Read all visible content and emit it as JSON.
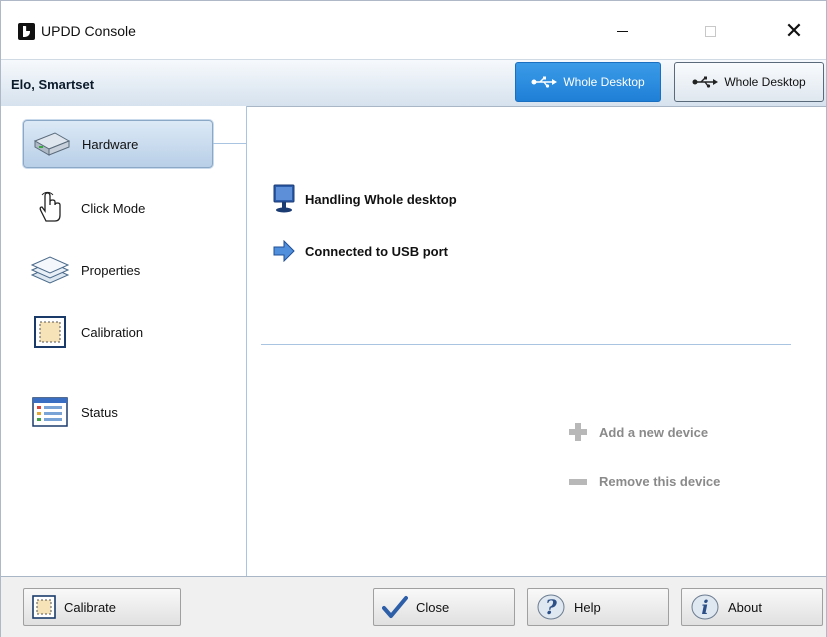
{
  "window": {
    "title": "UPDD Console",
    "minimize_glyph": "—",
    "close_glyph": "✕"
  },
  "device_bar": {
    "device_name": "Elo, Smartset",
    "buttons": [
      {
        "label": "Whole Desktop",
        "state": "active",
        "icon": "usb-icon"
      },
      {
        "label": "Whole Desktop",
        "state": "inactive",
        "icon": "usb-icon"
      }
    ]
  },
  "nav": {
    "items": [
      {
        "label": "Hardware",
        "icon": "hard-drive-icon",
        "selected": true
      },
      {
        "label": "Click Mode",
        "icon": "hand-pointer-icon",
        "selected": false
      },
      {
        "label": "Properties",
        "icon": "layers-icon",
        "selected": false
      },
      {
        "label": "Calibration",
        "icon": "calibration-icon",
        "selected": false
      },
      {
        "label": "Status",
        "icon": "status-grid-icon",
        "selected": false
      }
    ]
  },
  "content": {
    "info": [
      {
        "text": "Handling Whole desktop",
        "icon": "monitor-icon"
      },
      {
        "text": "Connected to USB port",
        "icon": "arrow-right-icon"
      }
    ],
    "actions": [
      {
        "label": "Add a new device",
        "icon": "plus-icon",
        "enabled": false
      },
      {
        "label": "Remove this device",
        "icon": "minus-icon",
        "enabled": false
      }
    ]
  },
  "footer": {
    "calibrate": "Calibrate",
    "close": "Close",
    "help": "Help",
    "about": "About"
  },
  "colors": {
    "accent": "#1f7fd6",
    "selected_bg": "#c9dbee",
    "disabled_text": "#8a8a8a"
  }
}
